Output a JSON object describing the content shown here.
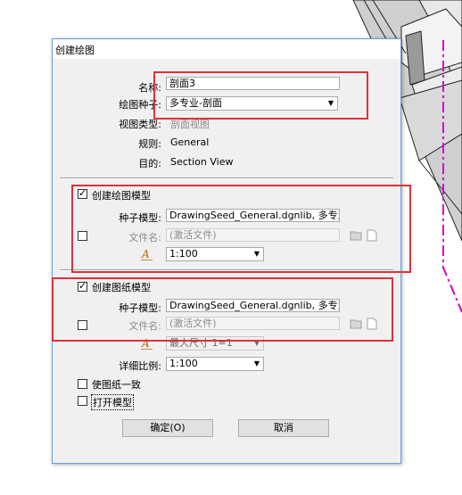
{
  "dialog": {
    "title": "创建绘图",
    "name_label": "名称:",
    "name_value": "剖面3",
    "seed_label": "绘图种子:",
    "seed_value": "多专业-剖面",
    "viewtype_label": "视图类型:",
    "viewtype_value": "剖面视图",
    "rule_label": "规则:",
    "rule_value": "General",
    "purpose_label": "目的:",
    "purpose_value": "Section View"
  },
  "drawing_model": {
    "checkbox_label": "创建绘图模型",
    "checked": true,
    "seed_label": "种子模型:",
    "seed_value": "DrawingSeed_General.dgnlib, 多专业-剖",
    "file_checked": false,
    "file_label": "文件名:",
    "file_value": "(激活文件)",
    "scale_value": "1:100"
  },
  "sheet_model": {
    "checkbox_label": "创建图纸模型",
    "checked": true,
    "seed_label": "种子模型:",
    "seed_value": "DrawingSeed_General.dgnlib, 多专业-剖",
    "file_checked": false,
    "file_label": "文件名:",
    "file_value": "(激活文件)",
    "size_value": "最大尺寸 1=1",
    "detail_scale_label": "详细比例:",
    "detail_scale_value": "1:100"
  },
  "options": {
    "make_consistent_label": "使图纸一致",
    "make_consistent_checked": false,
    "open_model_label": "打开模型",
    "open_model_checked": false
  },
  "buttons": {
    "ok_label": "确定(O)",
    "cancel_label": "取消"
  },
  "colors": {
    "highlight_box": "#e0303a",
    "section_line": "#d400d4",
    "dialog_border": "#6d9ed8"
  }
}
